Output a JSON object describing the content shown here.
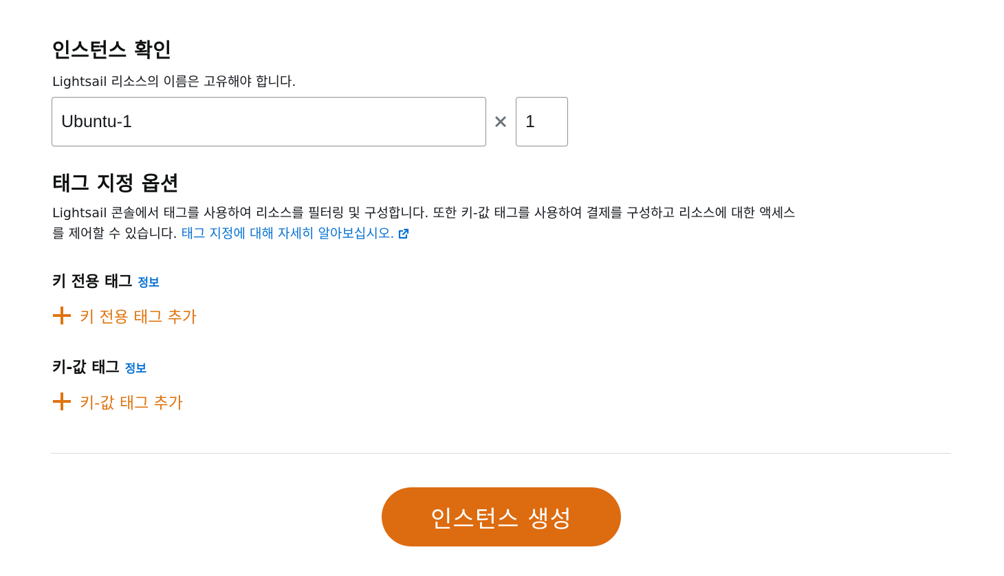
{
  "confirm_instance": {
    "title": "인스턴스 확인",
    "description": "Lightsail 리소스의 이름은 고유해야 합니다.",
    "name_value": "Ubuntu-1",
    "count_value": "1",
    "multiply_symbol": "×"
  },
  "tagging": {
    "title": "태그 지정 옵션",
    "description": "Lightsail 콘솔에서 태그를 사용하여 리소스를 필터링 및 구성합니다. 또한 키-값 태그를 사용하여 결제를 구성하고 리소스에 대한 액세스를 제어할 수 있습니다. ",
    "learn_more_link": "태그 지정에 대해 자세히 알아보십시오.",
    "external_icon": "external-link-icon"
  },
  "key_only_tags": {
    "title": "키 전용 태그",
    "info": "정보",
    "add_label": "키 전용 태그 추가",
    "icon": "plus-icon"
  },
  "key_value_tags": {
    "title": "키-값 태그",
    "info": "정보",
    "add_label": "키-값 태그 추가",
    "icon": "plus-icon"
  },
  "actions": {
    "create_label": "인스턴스 생성"
  },
  "colors": {
    "accent_orange": "#dd6b10",
    "add_orange": "#e07410",
    "link_blue": "#0972d3",
    "divider": "#d5dbdb"
  }
}
